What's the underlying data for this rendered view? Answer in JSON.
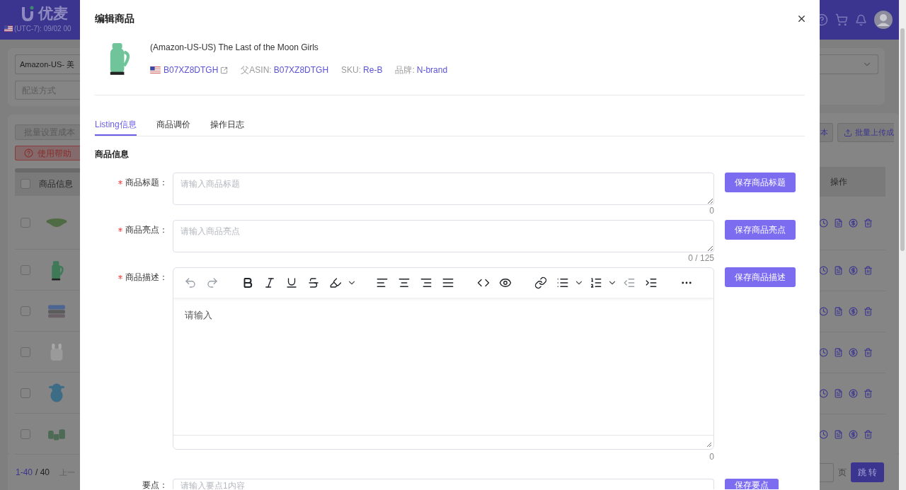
{
  "background": {
    "logo": "优麦",
    "timezone": "(UTC-7): 09/02 00",
    "marketplace_select": "Amazon-US- 美",
    "shipping_field": {
      "placeholder": "配送方式"
    },
    "buttons_left": [
      {
        "label": "批量设置成本",
        "kind": "default"
      },
      {
        "label": "使用帮助",
        "kind": "help"
      }
    ],
    "buttons_right": [
      {
        "label": "本",
        "kind": "default"
      },
      {
        "label": "批量上传成",
        "kind": "upload"
      }
    ],
    "table": {
      "columns": [
        {
          "label": "商品信息"
        },
        {
          "label": "操作"
        }
      ],
      "header_checked": false,
      "rows": [
        {
          "checked": false
        },
        {
          "checked": false
        },
        {
          "checked": false
        },
        {
          "checked": false
        },
        {
          "checked": false
        },
        {
          "checked": false
        }
      ]
    },
    "pagination": {
      "range": "1-40",
      "total": "/ 40",
      "prev": "上一",
      "page_unit": "页",
      "jump": "跳 转"
    }
  },
  "modal": {
    "title": "编辑商品",
    "product": {
      "title": "(Amazon-US-US) The Last of the Moon Girls",
      "asin": "B07XZ8DTGH",
      "meta": [
        {
          "label": "父ASIN:",
          "value": "B07XZ8DTGH"
        },
        {
          "label": "SKU:",
          "value": "Re-B"
        },
        {
          "label": "品牌:",
          "value": "N-brand"
        }
      ]
    },
    "tabs": [
      {
        "label": "Listing信息",
        "selected": true
      },
      {
        "label": "商品调价",
        "selected": false
      },
      {
        "label": "操作日志",
        "selected": false
      }
    ],
    "section_title": "商品信息",
    "fields": [
      {
        "kind": "textarea",
        "label": "商品标题：",
        "required": true,
        "placeholder": "请输入商品标题",
        "counter": "0",
        "button": "保存商品标题"
      },
      {
        "kind": "textarea",
        "label": "商品亮点：",
        "required": true,
        "placeholder": "请输入商品亮点",
        "counter": "0 / 125",
        "button": "保存商品亮点"
      },
      {
        "kind": "editor",
        "label": "商品描述：",
        "required": true,
        "placeholder": "请输入",
        "counter": "0",
        "button": "保存商品描述",
        "toolbar": [
          [
            {
              "kind": "undo",
              "disabled": true
            },
            {
              "kind": "redo",
              "disabled": true
            }
          ],
          [
            {
              "kind": "bold",
              "disabled": false
            },
            {
              "kind": "italic",
              "disabled": false
            },
            {
              "kind": "underline",
              "disabled": false
            },
            {
              "kind": "strike",
              "disabled": false
            },
            {
              "kind": "highlight",
              "disabled": false
            }
          ],
          [
            {
              "kind": "align-left",
              "disabled": false
            },
            {
              "kind": "align-center",
              "disabled": false
            },
            {
              "kind": "align-right",
              "disabled": false
            },
            {
              "kind": "justify",
              "disabled": false
            }
          ],
          [
            {
              "kind": "code",
              "disabled": false
            },
            {
              "kind": "preview",
              "disabled": false
            }
          ],
          [
            {
              "kind": "link",
              "disabled": false
            },
            {
              "kind": "bullet-list",
              "disabled": false
            },
            {
              "kind": "ordered-list",
              "disabled": false
            },
            {
              "kind": "outdent",
              "disabled": true
            },
            {
              "kind": "indent",
              "disabled": false
            }
          ],
          [
            {
              "kind": "more",
              "disabled": false
            }
          ]
        ]
      },
      {
        "kind": "input",
        "label": "要点：",
        "required": false,
        "placeholder": "请输入要点1内容",
        "button": "保存要点"
      }
    ]
  }
}
